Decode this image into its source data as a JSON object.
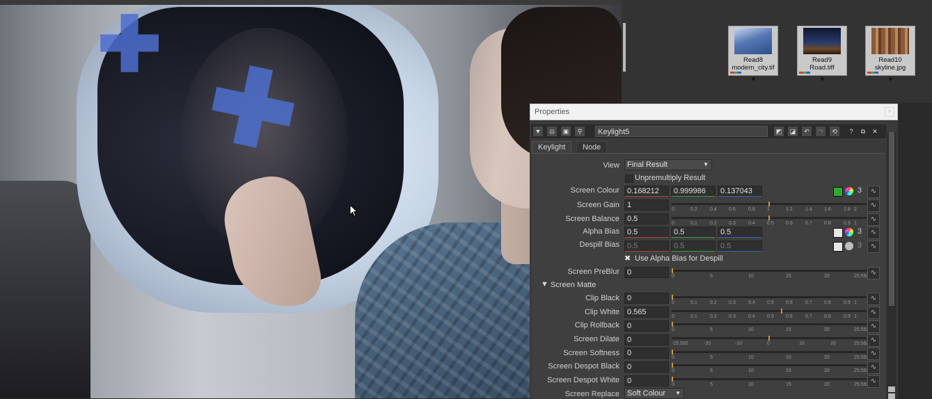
{
  "viewer": {
    "scene": "airplane window footage with tracking markers"
  },
  "nodegraph": {
    "nodes": [
      {
        "id": "Read8",
        "file": "modern_city.tif"
      },
      {
        "id": "Read9",
        "file": "Road.tiff"
      },
      {
        "id": "Read10",
        "file": "skyline.jpg"
      }
    ]
  },
  "properties": {
    "title": "Properties",
    "node_name": "Keylight5",
    "tabs": [
      "Keylight",
      "Node"
    ],
    "view": {
      "label": "View",
      "value": "Final Result"
    },
    "unpremultiply": {
      "label": "Unpremultiply Result"
    },
    "screen_colour": {
      "label": "Screen Colour",
      "r": "0.168212",
      "g": "0.999986",
      "b": "0.137043",
      "channels": "3"
    },
    "screen_gain": {
      "label": "Screen Gain",
      "value": "1",
      "ticks": [
        "0",
        "0.2",
        "0.4",
        "0.6",
        "0.8",
        "1",
        "1.2",
        "1.4",
        "1.6",
        "1.8",
        "2"
      ]
    },
    "screen_balance": {
      "label": "Screen Balance",
      "value": "0.5",
      "ticks": [
        "0",
        "0.1",
        "0.2",
        "0.3",
        "0.4",
        "0.5",
        "0.6",
        "0.7",
        "0.8",
        "0.9",
        "1"
      ]
    },
    "alpha_bias": {
      "label": "Alpha Bias",
      "r": "0.5",
      "g": "0.5",
      "b": "0.5",
      "channels": "3"
    },
    "despill_bias": {
      "label": "Despill Bias",
      "r": "0.5",
      "g": "0.5",
      "b": "0.5",
      "channels": "3"
    },
    "use_alpha_bias": {
      "label": "Use Alpha Bias for Despill"
    },
    "screen_preblur": {
      "label": "Screen PreBlur",
      "value": "0",
      "ticks": [
        "0",
        "5",
        "10",
        "15",
        "20",
        "25.592"
      ]
    },
    "screen_matte": {
      "label": "Screen Matte"
    },
    "clip_black": {
      "label": "Clip Black",
      "value": "0",
      "ticks": [
        "0",
        "0.1",
        "0.2",
        "0.3",
        "0.4",
        "0.5",
        "0.6",
        "0.7",
        "0.8",
        "0.9",
        "1"
      ]
    },
    "clip_white": {
      "label": "Clip White",
      "value": "0.565",
      "ticks": [
        "0",
        "0.1",
        "0.2",
        "0.3",
        "0.4",
        "0.5",
        "0.6",
        "0.7",
        "0.8",
        "0.9",
        "1"
      ]
    },
    "clip_rollback": {
      "label": "Clip Rollback",
      "value": "0",
      "ticks": [
        "0",
        "5",
        "10",
        "15",
        "20",
        "25.592"
      ]
    },
    "screen_dilate": {
      "label": "Screen Dilate",
      "value": "0",
      "ticks": [
        "-25.592",
        "-20",
        "-10",
        "0",
        "10",
        "20",
        "25.592"
      ]
    },
    "screen_softness": {
      "label": "Screen Softness",
      "value": "0",
      "ticks": [
        "0",
        "5",
        "10",
        "15",
        "20",
        "25.592"
      ]
    },
    "despot_black": {
      "label": "Screen Despot Black",
      "value": "0",
      "ticks": [
        "0",
        "5",
        "10",
        "15",
        "20",
        "25.592"
      ]
    },
    "despot_white": {
      "label": "Screen Despot White",
      "value": "0",
      "ticks": [
        "0",
        "5",
        "10",
        "15",
        "20",
        "25.592"
      ]
    },
    "screen_replace": {
      "label": "Screen Replace",
      "value": "Soft Colour"
    }
  }
}
